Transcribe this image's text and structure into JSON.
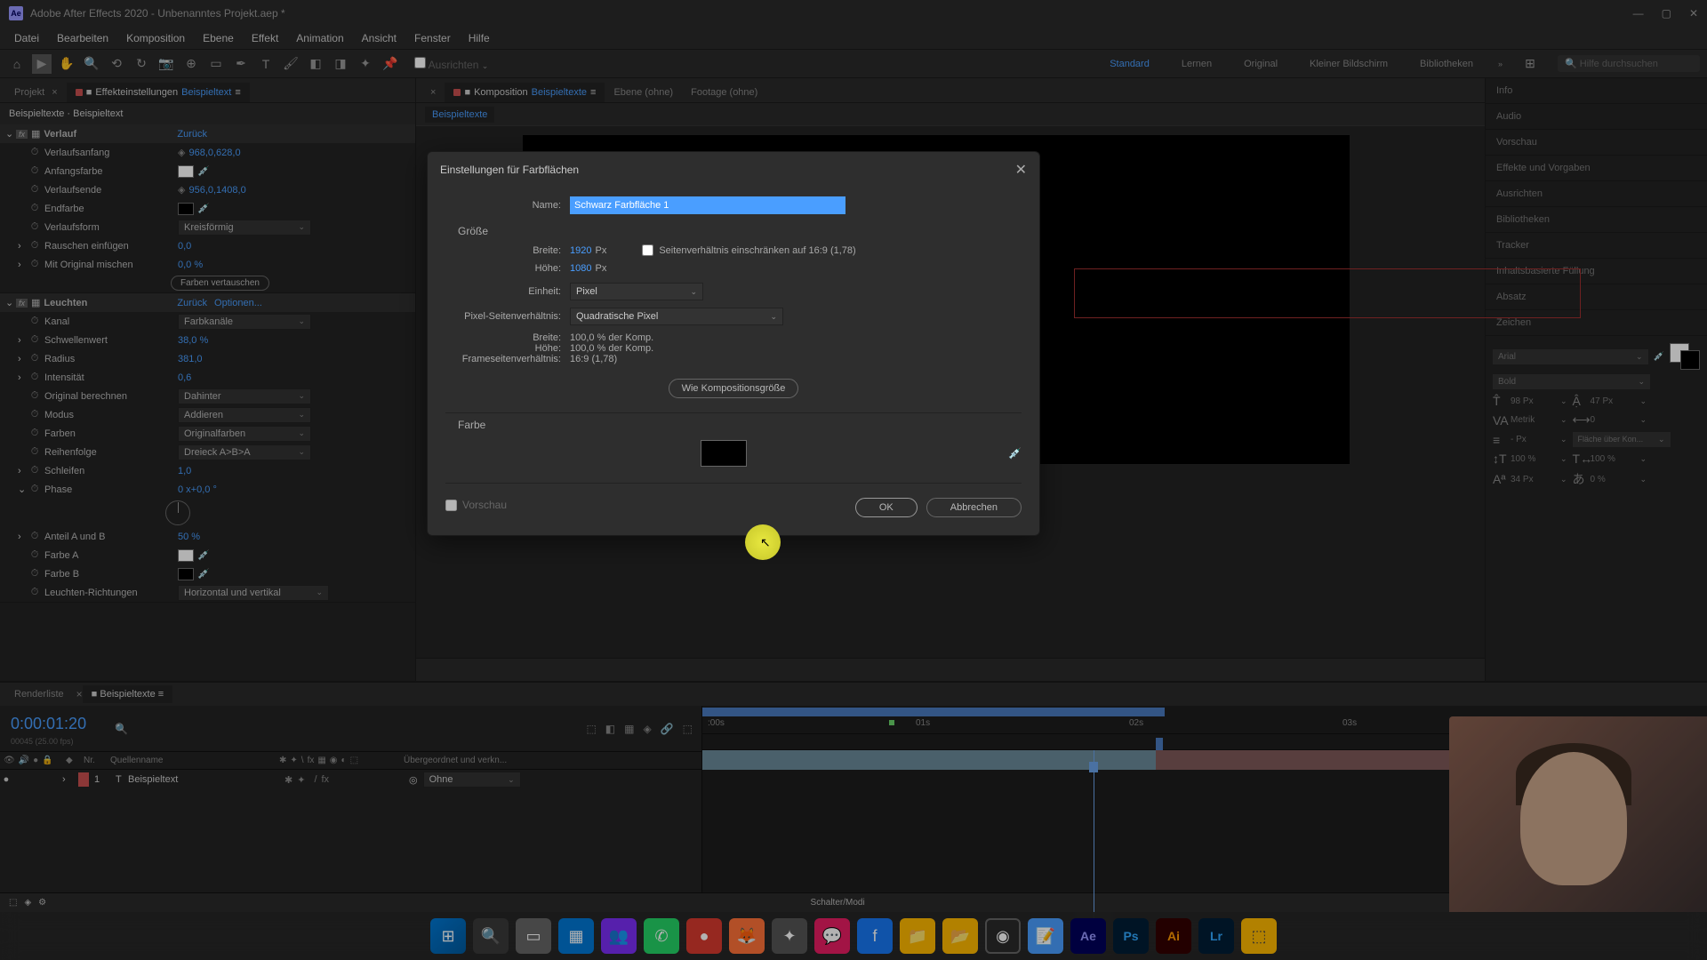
{
  "titlebar": {
    "app_icon": "Ae",
    "title": "Adobe After Effects 2020 - Unbenanntes Projekt.aep *"
  },
  "menu": [
    "Datei",
    "Bearbeiten",
    "Komposition",
    "Ebene",
    "Effekt",
    "Animation",
    "Ansicht",
    "Fenster",
    "Hilfe"
  ],
  "toolbar": {
    "workspaces": [
      "Standard",
      "Lernen",
      "Original",
      "Kleiner Bildschirm",
      "Bibliotheken"
    ],
    "active_workspace": "Standard",
    "align_label": "Ausrichten",
    "search_placeholder": "Hilfe durchsuchen"
  },
  "left_tabs": {
    "project": "Projekt",
    "effect_controls_prefix": "Effekteinstellungen",
    "effect_controls_name": "Beispieltext"
  },
  "effects_header": "Beispieltexte · Beispieltext",
  "fx1": {
    "name": "Verlauf",
    "reset": "Zurück",
    "props": {
      "anfang": {
        "label": "Verlaufsanfang",
        "value": "968,0,628,0"
      },
      "anfangsfarbe": {
        "label": "Anfangsfarbe"
      },
      "ende": {
        "label": "Verlaufsende",
        "value": "956,0,1408,0"
      },
      "endfarbe": {
        "label": "Endfarbe"
      },
      "form": {
        "label": "Verlaufsform",
        "value": "Kreisförmig"
      },
      "rauschen": {
        "label": "Rauschen einfügen",
        "value": "0,0"
      },
      "mischen": {
        "label": "Mit Original mischen",
        "value": "0,0 %"
      },
      "vertauschen": "Farben vertauschen"
    }
  },
  "fx2": {
    "name": "Leuchten",
    "reset": "Zurück",
    "options": "Optionen...",
    "props": {
      "kanal": {
        "label": "Kanal",
        "value": "Farbkanäle"
      },
      "schwell": {
        "label": "Schwellenwert",
        "value": "38,0 %"
      },
      "radius": {
        "label": "Radius",
        "value": "381,0"
      },
      "intens": {
        "label": "Intensität",
        "value": "0,6"
      },
      "orig": {
        "label": "Original berechnen",
        "value": "Dahinter"
      },
      "modus": {
        "label": "Modus",
        "value": "Addieren"
      },
      "farben": {
        "label": "Farben",
        "value": "Originalfarben"
      },
      "reihen": {
        "label": "Reihenfolge",
        "value": "Dreieck A>B>A"
      },
      "schleifen": {
        "label": "Schleifen",
        "value": "1,0"
      },
      "phase": {
        "label": "Phase",
        "value": "0 x+0,0 °"
      },
      "anteil": {
        "label": "Anteil A und B",
        "value": "50 %"
      },
      "farbeA": {
        "label": "Farbe A"
      },
      "farbeB": {
        "label": "Farbe B"
      },
      "richt": {
        "label": "Leuchten-Richtungen",
        "value": "Horizontal und vertikal"
      }
    }
  },
  "comp": {
    "tabs_prefix": "Komposition",
    "tabs_name": "Beispieltexte",
    "tab_ebene": "Ebene  (ohne)",
    "tab_footage": "Footage  (ohne)",
    "breadcrumb": "Beispieltexte"
  },
  "dialog": {
    "title": "Einstellungen für Farbflächen",
    "name_label": "Name:",
    "name_value": "Schwarz Farbfläche 1",
    "size_label": "Größe",
    "width_label": "Breite:",
    "width_value": "1920",
    "px": "Px",
    "height_label": "Höhe:",
    "height_value": "1080",
    "lock_aspect": "Seitenverhältnis einschränken auf 16:9 (1,78)",
    "unit_label": "Einheit:",
    "unit_value": "Pixel",
    "par_label": "Pixel-Seitenverhältnis:",
    "par_value": "Quadratische Pixel",
    "info_w": "Breite:",
    "info_w_val": "100,0 % der Komp.",
    "info_h": "Höhe:",
    "info_h_val": "100,0 % der Komp.",
    "info_far": "Frameseitenverhältnis:",
    "info_far_val": "16:9 (1,78)",
    "comp_size_btn": "Wie Kompositionsgröße",
    "color_label": "Farbe",
    "preview": "Vorschau",
    "ok": "OK",
    "cancel": "Abbrechen"
  },
  "right_sections": [
    "Info",
    "Audio",
    "Vorschau",
    "Effekte und Vorgaben",
    "Ausrichten",
    "Bibliotheken",
    "Tracker",
    "Inhaltsbasierte Füllung",
    "Absatz",
    "Zeichen"
  ],
  "char": {
    "font": "Arial",
    "weight": "Bold",
    "size": "47 Px",
    "leading": "98 Px",
    "kerning": "Metrik",
    "tracking": "0",
    "va": "VA",
    "stroke": "- Px",
    "fill_over": "Fläche über Kon...",
    "vscale": "100 %",
    "hscale": "100 %",
    "baseline": "34 Px",
    "tsume": "0 %"
  },
  "timeline": {
    "tab_render": "Renderliste",
    "tab_comp": "Beispieltexte",
    "timecode": "0:00:01:20",
    "timecode_sub": "00045 (25.00 fps)",
    "col_nr": "Nr.",
    "col_source": "Quellenname",
    "col_parent": "Übergeordnet und verkn...",
    "layer_num": "1",
    "layer_name": "Beispieltext",
    "parent_value": "Ohne",
    "ticks": [
      ":00s",
      "01s",
      "02s",
      "03s"
    ],
    "footer_label": "Schalter/Modi"
  }
}
